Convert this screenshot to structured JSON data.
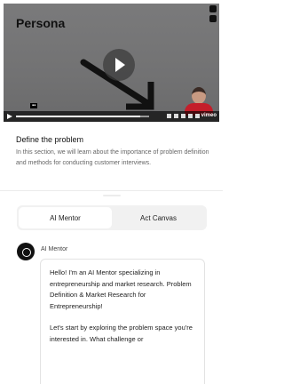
{
  "video": {
    "title": "Persona",
    "player_brand": "vimeo",
    "progress": 0.93
  },
  "section": {
    "title": "Define the problem",
    "description": "In this section, we will learn about the importance of problem definition and methods for conducting customer interviews."
  },
  "tabs": [
    {
      "label": "AI Mentor",
      "active": true
    },
    {
      "label": "Act Canvas",
      "active": false
    }
  ],
  "chat": {
    "sender": "AI Mentor",
    "message_p1": "Hello! I'm an AI Mentor specializing in entrepreneurship and market research. Problem Definition & Market Research for Entrepreneurship!",
    "message_p2": "Let's start by exploring the problem space you're interested in. What challenge or"
  }
}
